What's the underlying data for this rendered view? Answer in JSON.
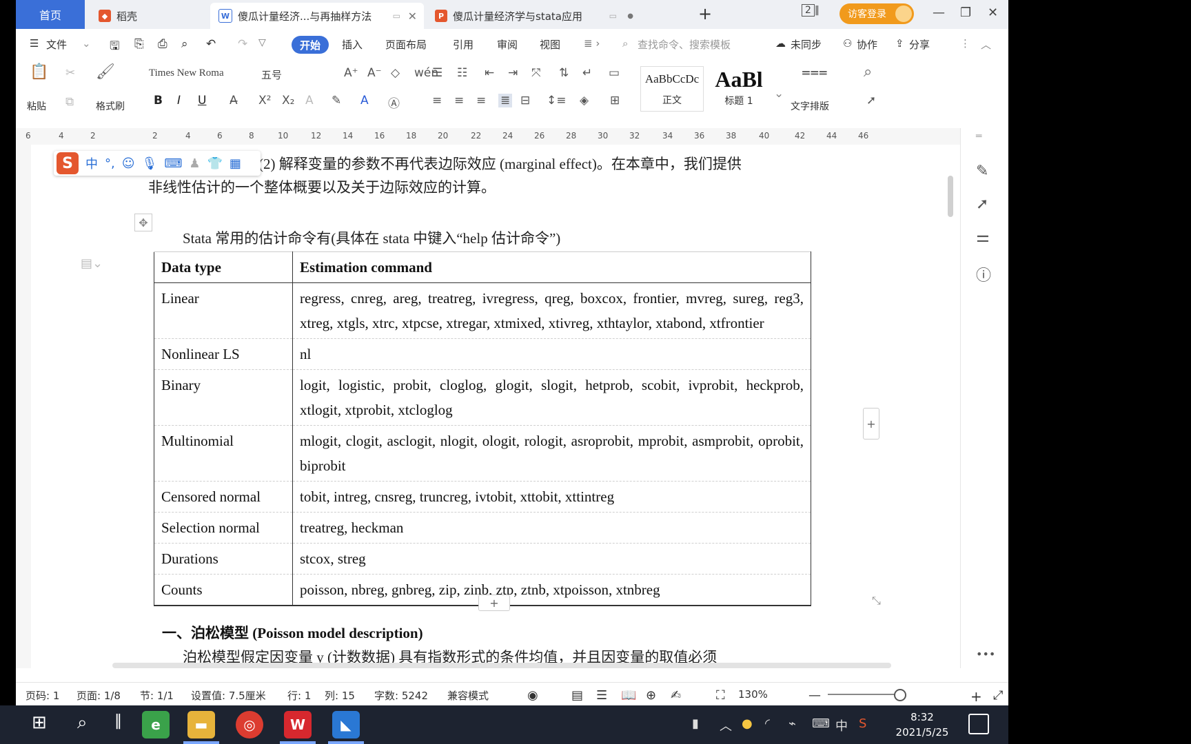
{
  "tabs": {
    "home": "首页",
    "daoke": "稻壳",
    "doc1": "傻瓜计量经济...与再抽样方法",
    "doc2": "傻瓜计量经济学与stata应用",
    "login": "访客登录",
    "page_count": "2"
  },
  "menu": {
    "file": "文件",
    "start": "开始",
    "insert": "插入",
    "layout": "页面布局",
    "reference": "引用",
    "review": "审阅",
    "view": "视图",
    "search_placeholder": "查找命令、搜索模板",
    "sync": "未同步",
    "collab": "协作",
    "share": "分享"
  },
  "ribbon": {
    "paste": "粘贴",
    "format_painter": "格式刷",
    "font_name": "Times New Roma",
    "font_size": "五号",
    "style_normal_preview": "AaBbCcDc",
    "style_normal": "正文",
    "style_h1_preview": "AaBl",
    "style_h1": "标题 1",
    "text_layout": "文字排版"
  },
  "ruler_ticks": [
    "6",
    "4",
    "2",
    "2",
    "4",
    "6",
    "8",
    "10",
    "12",
    "14",
    "16",
    "18",
    "20",
    "22",
    "24",
    "26",
    "28",
    "30",
    "32",
    "34",
    "36",
    "38",
    "40",
    "42",
    "44",
    "46"
  ],
  "ime": {
    "mode": "中"
  },
  "document": {
    "line1": "(2) 解释变量的参数不再代表边际效应 (marginal effect)。在本章中，我们提供",
    "line2": "非线性估计的一个整体概要以及关于边际效应的计算。",
    "caption": "Stata 常用的估计命令有(具体在 stata 中键入“help  估计命令”)",
    "table": {
      "headers": [
        "Data type",
        "Estimation command"
      ],
      "rows": [
        {
          "type": "Linear",
          "commands": "regress, cnreg, areg, treatreg, ivregress, qreg, boxcox, frontier, mvreg, sureg, reg3, xtreg, xtgls, xtrc, xtpcse, xtregar, xtmixed, xtivreg, xthtaylor, xtabond, xtfrontier"
        },
        {
          "type": "Nonlinear LS",
          "commands": "nl"
        },
        {
          "type": "Binary",
          "commands": "logit, logistic, probit, cloglog, glogit, slogit, hetprob, scobit, ivprobit, heckprob, xtlogit, xtprobit, xtcloglog"
        },
        {
          "type": "Multinomial",
          "commands": "mlogit, clogit, asclogit, nlogit, ologit, rologit, asroprobit, mprobit, asmprobit, oprobit, biprobit"
        },
        {
          "type": "Censored normal",
          "commands": "tobit, intreg, cnsreg, truncreg, ivtobit, xttobit, xttintreg"
        },
        {
          "type": "Selection normal",
          "commands": "treatreg, heckman"
        },
        {
          "type": "Durations",
          "commands": "stcox, streg"
        },
        {
          "type": "Counts",
          "commands": "poisson, nbreg, gnbreg, zip, zinb, ztp, ztnb, xtpoisson, xtnbreg"
        }
      ]
    },
    "heading": "一、泊松模型 (Poisson model description)",
    "line_bottom": "泊松模型假定因变量 y (计数数据) 具有指数形式的条件均值，并且因变量的取值必须"
  },
  "status": {
    "page_code": "页码: 1",
    "page": "页面: 1/8",
    "section": "节: 1/1",
    "setting": "设置值: 7.5厘米",
    "row": "行: 1",
    "col": "列: 15",
    "words": "字数: 5242",
    "compat": "兼容模式",
    "zoom": "130%"
  },
  "taskbar": {
    "time": "8:32",
    "date": "2021/5/25",
    "ime_lang": "中"
  }
}
